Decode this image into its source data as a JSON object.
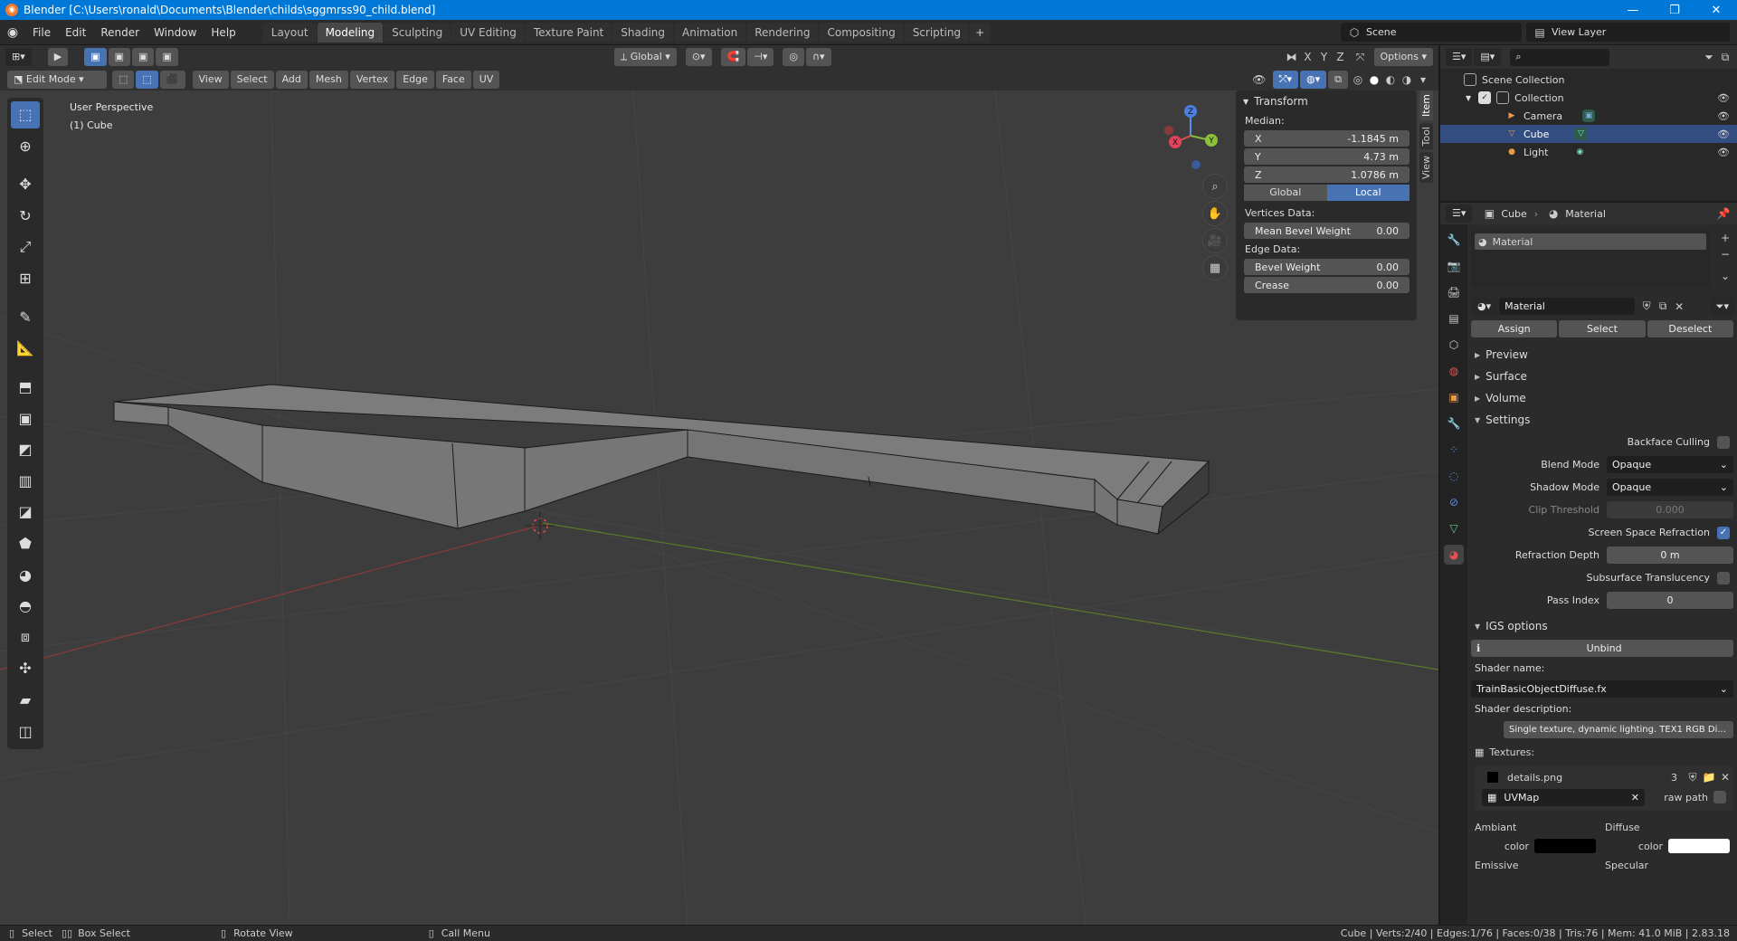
{
  "titlebar": {
    "title": "Blender [C:\\Users\\ronald\\Documents\\Blender\\childs\\sggmrss90_child.blend]"
  },
  "topbar": {
    "menus": [
      "File",
      "Edit",
      "Render",
      "Window",
      "Help"
    ],
    "workspaces": [
      "Layout",
      "Modeling",
      "Sculpting",
      "UV Editing",
      "Texture Paint",
      "Shading",
      "Animation",
      "Rendering",
      "Compositing",
      "Scripting"
    ],
    "active_workspace": "Modeling",
    "scene": "Scene",
    "view_layer": "View Layer"
  },
  "viewport_header": {
    "orientation": "Global",
    "axes": [
      "X",
      "Y",
      "Z"
    ],
    "options": "Options",
    "mode": "Edit Mode",
    "menus": [
      "View",
      "Select",
      "Add",
      "Mesh",
      "Vertex",
      "Edge",
      "Face",
      "UV"
    ]
  },
  "viewport": {
    "view_name": "User Perspective",
    "object_label": "(1) Cube",
    "gizmo_axes": {
      "x": "X",
      "y": "Y",
      "z": "Z"
    }
  },
  "npanel": {
    "tabs": [
      "Item",
      "Tool",
      "View"
    ],
    "section": "Transform",
    "median_label": "Median:",
    "x": {
      "label": "X",
      "value": "-1.1845 m"
    },
    "y": {
      "label": "Y",
      "value": "4.73 m"
    },
    "z": {
      "label": "Z",
      "value": "1.0786 m"
    },
    "global": "Global",
    "local": "Local",
    "vertices_label": "Vertices Data:",
    "mean_bevel": {
      "label": "Mean Bevel Weight",
      "value": "0.00"
    },
    "edge_label": "Edge Data:",
    "bevel_weight": {
      "label": "Bevel Weight",
      "value": "0.00"
    },
    "crease": {
      "label": "Crease",
      "value": "0.00"
    }
  },
  "outliner": {
    "scene_collection": "Scene Collection",
    "collection": "Collection",
    "items": [
      "Camera",
      "Cube",
      "Light"
    ]
  },
  "properties": {
    "breadcrumb_object": "Cube",
    "breadcrumb_material": "Material",
    "slot": "Material",
    "material_name": "Material",
    "assign": "Assign",
    "select": "Select",
    "deselect": "Deselect",
    "sections": [
      "Preview",
      "Surface",
      "Volume",
      "Settings"
    ],
    "backface_culling": "Backface Culling",
    "blend_mode": {
      "label": "Blend Mode",
      "value": "Opaque"
    },
    "shadow_mode": {
      "label": "Shadow Mode",
      "value": "Opaque"
    },
    "clip_threshold": {
      "label": "Clip Threshold",
      "value": "0.000"
    },
    "ssr": "Screen Space Refraction",
    "refraction_depth": {
      "label": "Refraction Depth",
      "value": "0 m"
    },
    "subsurface": "Subsurface Translucency",
    "pass_index": {
      "label": "Pass Index",
      "value": "0"
    },
    "igs": "IGS options",
    "unbind": "Unbind",
    "shader_name_label": "Shader name:",
    "shader_name": "TrainBasicObjectDiffuse.fx",
    "shader_desc_label": "Shader description:",
    "shader_desc": "Single texture, dynamic lighting. TEX1 RGB Di...",
    "textures_label": "Textures:",
    "texture_file": "details.png",
    "texture_users": "3",
    "uvmap": "UVMap",
    "raw_path": "raw path",
    "ambiant": "Ambiant",
    "diffuse": "Diffuse",
    "color": "color",
    "emissive": "Emissive",
    "specular": "Specular"
  },
  "statusbar": {
    "select": "Select",
    "box_select": "Box Select",
    "rotate": "Rotate View",
    "call_menu": "Call Menu",
    "stats": "Cube | Verts:2/40 | Edges:1/76 | Faces:0/38 | Tris:76 | Mem: 41.0 MiB | 2.83.18"
  },
  "colors": {
    "accent": "#4772b3",
    "title": "#0078d7",
    "ambiant_swatch": "#000000",
    "diffuse_swatch": "#ffffff"
  }
}
